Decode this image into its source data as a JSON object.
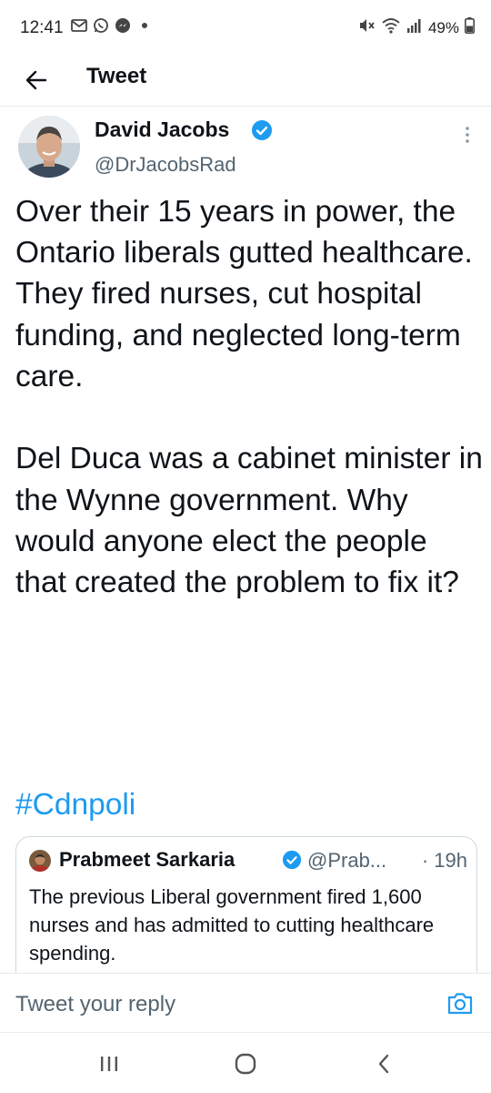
{
  "status_bar": {
    "time": "12:41",
    "battery": "49%",
    "left_icons": [
      "gmail-icon",
      "whatsapp-icon",
      "messenger-icon",
      "notification-dot-icon"
    ],
    "right_icons": [
      "mute-icon",
      "wifi-icon",
      "signal-icon",
      "battery-icon"
    ]
  },
  "header": {
    "title": "Tweet",
    "back_icon": "back-arrow-icon"
  },
  "tweet": {
    "author_name": "David Jacobs",
    "author_handle": "@DrJacobsRad",
    "verified": true,
    "text": "Over their 15 years in power, the Ontario liberals gutted healthcare. They fired nurses, cut hospital funding, and neglected long-term care.\n\nDel Duca was a cabinet minister in the Wynne government. Why would anyone elect the people that created the problem to fix it?",
    "hashtag": "#Cdnpoli"
  },
  "quote_tweet": {
    "author_name": "Prabmeet Sarkaria",
    "author_handle": "@Prab...",
    "separator": "·",
    "time": "19h",
    "text": "The previous Liberal government fired 1,600 nurses and has admitted to cutting healthcare spending."
  },
  "reply": {
    "placeholder": "Tweet your reply"
  },
  "colors": {
    "accent": "#1d9bf0",
    "text": "#0f1419",
    "secondary_text": "#536471",
    "border": "#cfd9de"
  }
}
